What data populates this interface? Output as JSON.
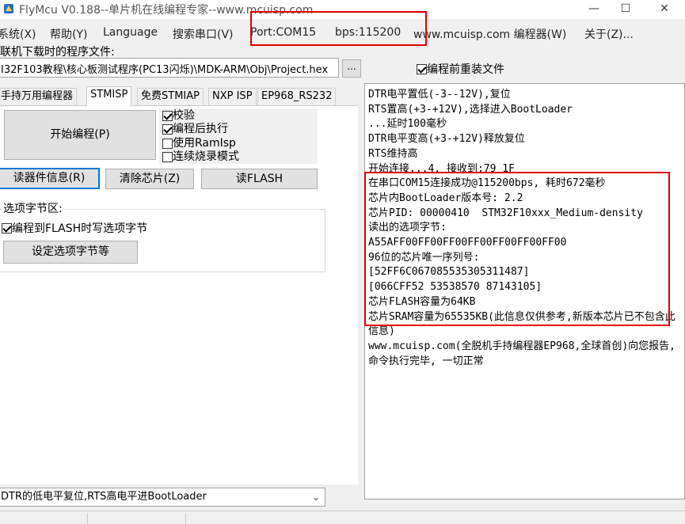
{
  "window": {
    "title": "FlyMcu V0.188--单片机在线编程专家--www.mcuisp.com",
    "minimize": "—",
    "maximize": "☐",
    "close": "✕"
  },
  "menu": {
    "items": [
      "系统(X)",
      "帮助(Y)",
      "Language",
      "搜索串口(V)",
      "Port:COM15",
      "bps:115200",
      "www.mcuisp.com 编程器(W)",
      "关于(Z)..."
    ]
  },
  "file": {
    "label": "联机下载时的程序文件:",
    "path": "I32F103教程\\核心板测试程序(PC13闪烁)\\MDK-ARM\\Obj\\Project.hex",
    "browse": "...",
    "reload_label": "编程前重装文件",
    "reload_checked": true
  },
  "tabs": [
    "手持万用编程器",
    "STMISP",
    "免费STMIAP",
    "NXP ISP",
    "EP968_RS232"
  ],
  "stmisp": {
    "start_button": "开始编程(P)",
    "options": [
      {
        "label": "校验",
        "checked": true
      },
      {
        "label": "编程后执行",
        "checked": true
      },
      {
        "label": "使用RamIsp",
        "checked": false
      },
      {
        "label": "连续烧录模式",
        "checked": false
      }
    ],
    "read_info": "读器件信息(R)",
    "erase_chip": "清除芯片(Z)",
    "read_flash": "读FLASH",
    "option_group_title": "选项字节区:",
    "write_option_label": "编程到FLASH时写选项字节",
    "write_option_checked": true,
    "set_option_button": "设定选项字节等"
  },
  "reset_mode": {
    "selected": "DTR的低电平复位,RTS高电平进BootLoader"
  },
  "log": {
    "lines": [
      "DTR电平置低(-3--12V),复位",
      "RTS置高(+3-+12V),选择进入BootLoader",
      "...延时100毫秒",
      "DTR电平变高(+3-+12V)释放复位",
      "RTS维持高",
      "开始连接...4, 接收到:79 1F",
      "在串口COM15连接成功@115200bps, 耗时672毫秒",
      "芯片内BootLoader版本号: 2.2",
      "芯片PID: 00000410  STM32F10xxx_Medium-density",
      "读出的选项字节:",
      "A55AFF00FF00FF00FF00FF00FF00FF00",
      "96位的芯片唯一序列号:",
      "[52FF6C067085535305311487]",
      "[066CFF52 53538570 87143105]",
      "芯片FLASH容量为64KB",
      "芯片SRAM容量为65535KB(此信息仅供参考,新版本芯片已不包含此信息)",
      "www.mcuisp.com(全脱机手持编程器EP968,全球首创)向您报告, 命令执行完毕, 一切正常"
    ]
  },
  "colors": {
    "highlight_border": "#e00000",
    "focus_border": "#0078d7"
  }
}
